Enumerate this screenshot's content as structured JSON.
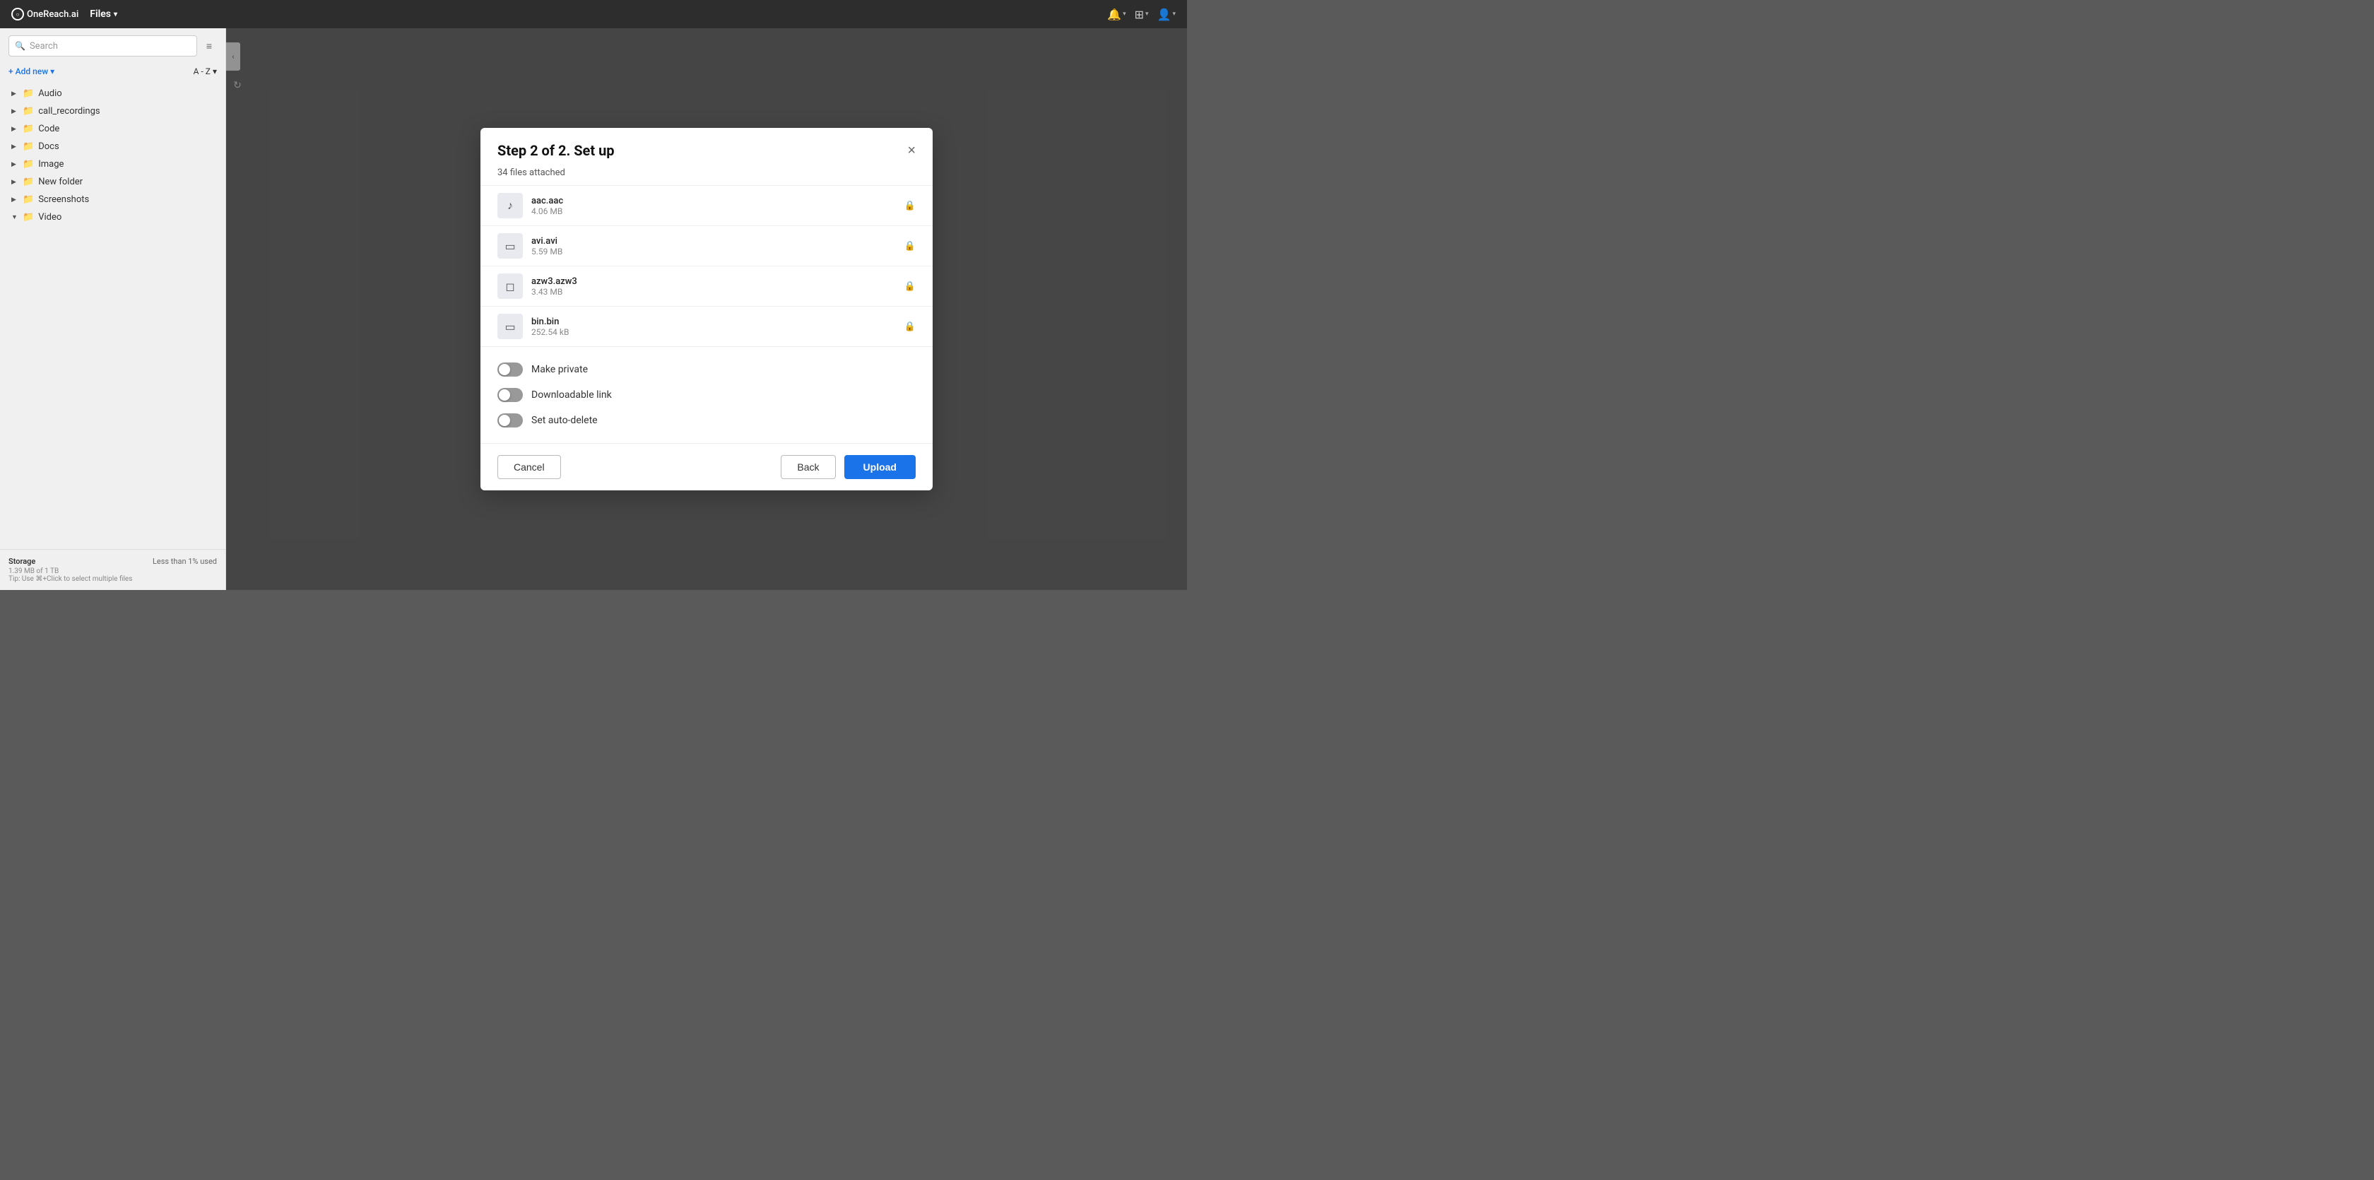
{
  "app": {
    "logo_text": "OneReach.ai",
    "nav_title": "Files",
    "nav_chevron": "▾"
  },
  "navbar": {
    "icons": [
      {
        "name": "bell-icon",
        "symbol": "🔔"
      },
      {
        "name": "grid-icon",
        "symbol": "⊞"
      },
      {
        "name": "user-icon",
        "symbol": "👤"
      }
    ]
  },
  "sidebar": {
    "search_placeholder": "Search",
    "search_label": "Search",
    "add_new_label": "+ Add new",
    "add_new_chevron": "▾",
    "sort_label": "A - Z",
    "sort_chevron": "▾",
    "tree_items": [
      {
        "id": "audio",
        "label": "Audio",
        "icon": "📁",
        "expanded": false
      },
      {
        "id": "call_recordings",
        "label": "call_recordings",
        "icon": "📁",
        "expanded": false
      },
      {
        "id": "code",
        "label": "Code",
        "icon": "📁",
        "expanded": false
      },
      {
        "id": "docs",
        "label": "Docs",
        "icon": "📁",
        "expanded": false
      },
      {
        "id": "image",
        "label": "Image",
        "icon": "📁",
        "expanded": false
      },
      {
        "id": "new_folder",
        "label": "New folder",
        "icon": "📁",
        "expanded": false
      },
      {
        "id": "screenshots",
        "label": "Screenshots",
        "icon": "📁",
        "expanded": false
      },
      {
        "id": "video",
        "label": "Video",
        "icon": "📁",
        "expanded": true
      }
    ],
    "storage": {
      "title": "Storage",
      "used_label": "Less than 1% used",
      "detail": "1.39 MB of 1 TB",
      "tip": "Tip: Use ⌘+Click to select multiple files"
    }
  },
  "modal": {
    "title": "Step 2 of 2. Set up",
    "files_count_label": "34 files attached",
    "files": [
      {
        "name": "aac.aac",
        "size": "4.06 MB",
        "icon": "♪",
        "icon_type": "audio"
      },
      {
        "name": "avi.avi",
        "size": "5.59 MB",
        "icon": "▭",
        "icon_type": "video"
      },
      {
        "name": "azw3.azw3",
        "size": "3.43 MB",
        "icon": "◻",
        "icon_type": "doc"
      },
      {
        "name": "bin.bin",
        "size": "252.54 kB",
        "icon": "▭",
        "icon_type": "generic"
      }
    ],
    "options": [
      {
        "id": "make_private",
        "label": "Make private",
        "enabled": false
      },
      {
        "id": "downloadable_link",
        "label": "Downloadable link",
        "enabled": false
      },
      {
        "id": "set_auto_delete",
        "label": "Set auto-delete",
        "enabled": false
      }
    ],
    "cancel_label": "Cancel",
    "back_label": "Back",
    "upload_label": "Upload"
  }
}
